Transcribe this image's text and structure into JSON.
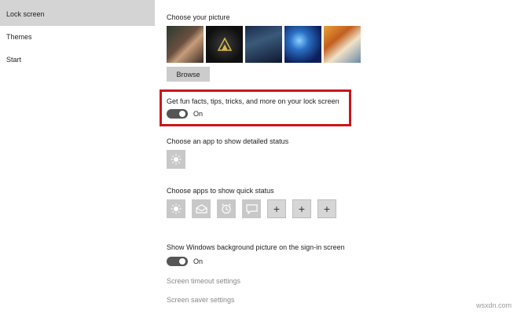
{
  "sidebar": {
    "items": [
      {
        "label": "Lock screen",
        "active": true
      },
      {
        "label": "Themes",
        "active": false
      },
      {
        "label": "Start",
        "active": false
      }
    ]
  },
  "picture": {
    "heading": "Choose your picture",
    "browse_label": "Browse"
  },
  "fun_facts": {
    "label": "Get fun facts, tips, tricks, and more on your lock screen",
    "state": "On"
  },
  "detailed_status": {
    "heading": "Choose an app to show detailed status",
    "apps": [
      "weather-icon"
    ]
  },
  "quick_status": {
    "heading": "Choose apps to show quick status",
    "apps": [
      "weather-icon",
      "mail-icon",
      "alarm-icon",
      "messaging-icon",
      "plus-icon",
      "plus-icon",
      "plus-icon"
    ]
  },
  "signin_background": {
    "label": "Show Windows background picture on the sign-in screen",
    "state": "On"
  },
  "links": {
    "timeout": "Screen timeout settings",
    "saver": "Screen saver settings"
  },
  "watermark": "wsxdn.com",
  "colors": {
    "highlight": "#c8161d",
    "toggle_on": "#555555",
    "sidebar_active": "#d4d4d4"
  }
}
